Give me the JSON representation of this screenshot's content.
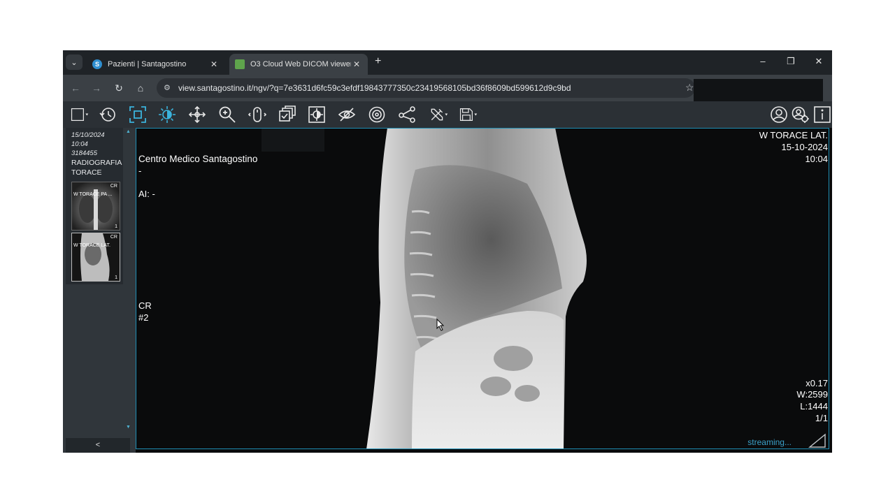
{
  "browser": {
    "tabs": [
      {
        "title": "Pazienti | Santagostino",
        "favicon": "S"
      },
      {
        "title": "O3 Cloud Web DICOM viewer",
        "favicon": "O3"
      }
    ],
    "new_tab": "+",
    "url": "view.santagostino.it/ngv/?q=7e3631d6fc59c3efdf19843777350c23419568105bd36f8609bd599612d9c9bd",
    "window_controls": {
      "minimize": "–",
      "restore": "❐",
      "close": "✕"
    }
  },
  "toolbar": {
    "icons": [
      "layout-icon",
      "history-icon",
      "fit-screen-icon",
      "window-level-icon",
      "pan-icon",
      "zoom-icon",
      "mouse-icon",
      "series-stack-icon",
      "invert-icon",
      "hide-overlay-icon",
      "target-icon",
      "share-icon",
      "tools-icon",
      "save-icon",
      "user-icon",
      "settings-user-icon",
      "info-icon"
    ]
  },
  "sidebar": {
    "date": "15/10/2024",
    "time": "10:04",
    "id": "3184455",
    "study_line1": "RADIOGRAFIA",
    "study_line2": "TORACE",
    "series": [
      {
        "modality": "CR",
        "title": "W TORACE PA ...",
        "count": "1"
      },
      {
        "modality": "CR",
        "title": "W TORACE LAT.",
        "count": "1"
      }
    ],
    "collapse": "<"
  },
  "viewer": {
    "institution": "Centro Medico Santagostino",
    "dash": "-",
    "ai": "AI: -",
    "modality": "CR",
    "series_num": "#2",
    "series_desc": "W TORACE LAT.",
    "date": "15-10-2024",
    "time": "10:04",
    "zoom": "x0.17",
    "window_width": "W:2599",
    "window_level": "L:1444",
    "image_index": "1/1",
    "streaming": "streaming..."
  }
}
